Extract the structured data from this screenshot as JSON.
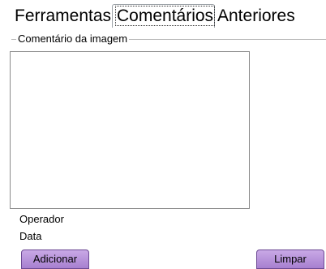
{
  "tabs": [
    {
      "label": "Ferramentas",
      "selected": false
    },
    {
      "label": "Comentários",
      "selected": true
    },
    {
      "label": "Anteriores",
      "selected": false
    }
  ],
  "comment_group": {
    "legend": "Comentário da imagem",
    "textarea_value": ""
  },
  "fields": {
    "operator_label": "Operador",
    "date_label": "Data"
  },
  "buttons": {
    "add_label": "Adicionar",
    "clear_label": "Limpar"
  },
  "colors": {
    "button_fill": "#b793dc",
    "button_border": "#6d4a94"
  }
}
